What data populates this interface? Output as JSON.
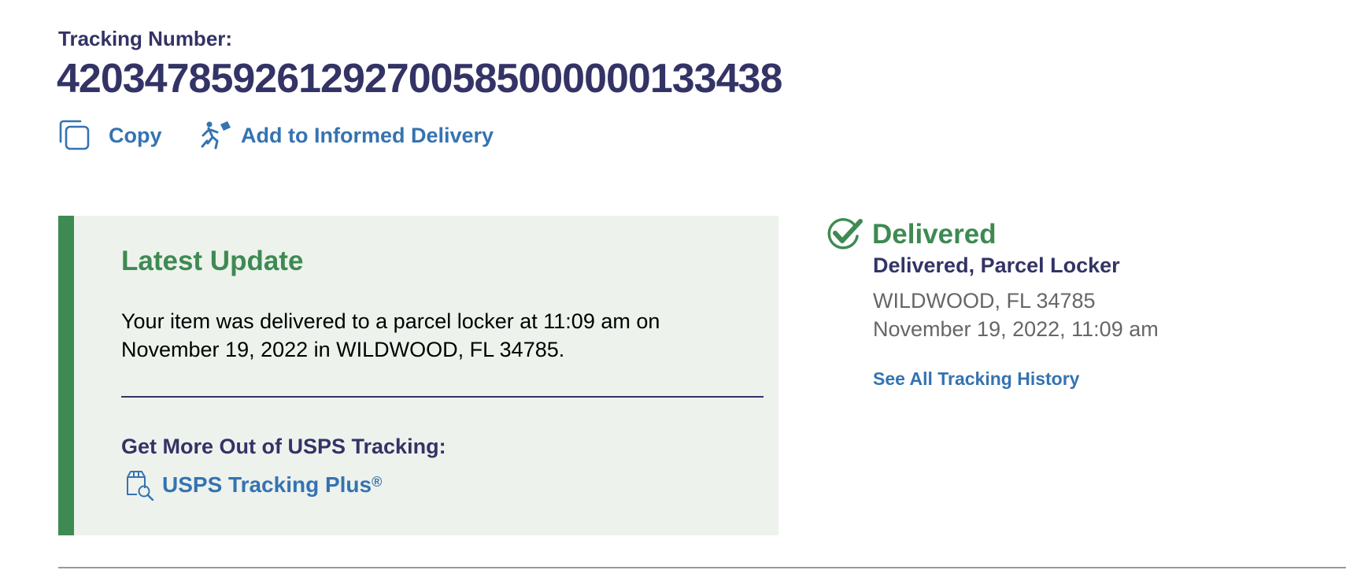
{
  "tracking": {
    "label": "Tracking Number:",
    "number": "420347859261292700585000000133438"
  },
  "actions": {
    "copy_label": "Copy",
    "copy_icon": "copy-icon",
    "informed_label": "Add to Informed Delivery",
    "informed_icon": "mail-carrier-icon"
  },
  "latest_update": {
    "title": "Latest Update",
    "body": "Your item was delivered to a parcel locker at 11:09 am on November 19, 2022 in WILDWOOD, FL 34785.",
    "more_heading": "Get More Out of USPS Tracking:",
    "plus_label": "USPS Tracking Plus",
    "plus_mark": "®",
    "plus_icon": "package-search-icon"
  },
  "status": {
    "icon": "check-circle-icon",
    "title": "Delivered",
    "detail": "Delivered, Parcel Locker",
    "location": "WILDWOOD, FL 34785",
    "datetime": "November 19, 2022, 11:09 am",
    "history_link": "See All Tracking History"
  },
  "colors": {
    "navy": "#333366",
    "link_blue": "#3573b1",
    "delivered_green": "#3e8a52",
    "panel_bg": "#edf2ed",
    "gray_text": "#666666"
  }
}
